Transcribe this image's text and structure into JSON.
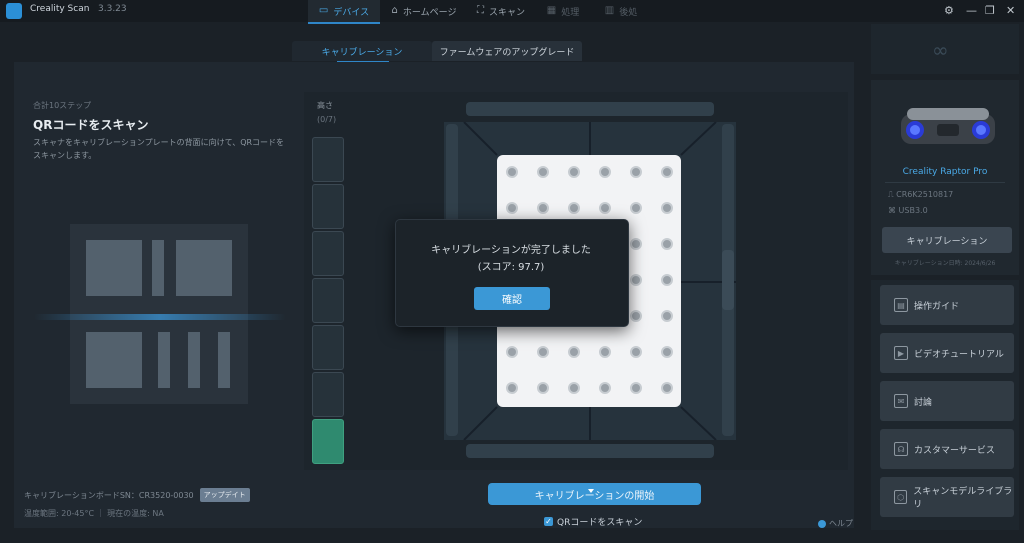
{
  "app": {
    "title": "Creality Scan",
    "version": "3.3.23"
  },
  "nav": {
    "tabs": [
      {
        "label": "デバイス",
        "icon": "device-icon"
      },
      {
        "label": "ホームページ",
        "icon": "home-icon"
      },
      {
        "label": "スキャン",
        "icon": "scan-icon"
      },
      {
        "label": "処理",
        "icon": "process-icon"
      },
      {
        "label": "後処",
        "icon": "postprocess-icon"
      }
    ]
  },
  "subtabs": {
    "calibration": "キャリブレーション",
    "firmware": "ファームウェアのアップグレード"
  },
  "left": {
    "step": "合計10ステップ",
    "title": "QRコードをスキャン",
    "desc": "スキャナをキャリブレーションプレートの背面に向けて、QRコードをスキャンします。",
    "board_info": "キャリブレーションボードSN：CR3520-0030",
    "badge": "アップデイト",
    "temp_info": "温度範囲: 20-45°C ｜ 現在の温度: NA"
  },
  "scan": {
    "height_label": "高さ",
    "height_value": "(0/7)",
    "height_segments_filled": 1,
    "start_button": "キャリブレーションの開始",
    "qr_checkbox": "QRコードをスキャン",
    "help": "ヘルプ"
  },
  "modal": {
    "message": "キャリブレーションが完了しました",
    "score": "(スコア: 97.7)",
    "confirm": "確認"
  },
  "device": {
    "name": "Creality Raptor Pro",
    "serial": "CR6K2510817",
    "port": "USB3.0",
    "calibrate_button": "キャリブレーション",
    "calib_date": "キャリブレーション日時: 2024/6/26"
  },
  "menu": [
    {
      "label": "操作ガイド",
      "icon": "guide-icon"
    },
    {
      "label": "ビデオチュートリアル",
      "icon": "video-icon"
    },
    {
      "label": "討論",
      "icon": "forum-icon"
    },
    {
      "label": "カスタマーサービス",
      "icon": "support-icon"
    },
    {
      "label": "スキャンモデルライブラリ",
      "icon": "library-icon"
    }
  ],
  "colors": {
    "accent": "#3b98d6",
    "fill": "#2f8a6f",
    "bg": "#1b2127"
  }
}
